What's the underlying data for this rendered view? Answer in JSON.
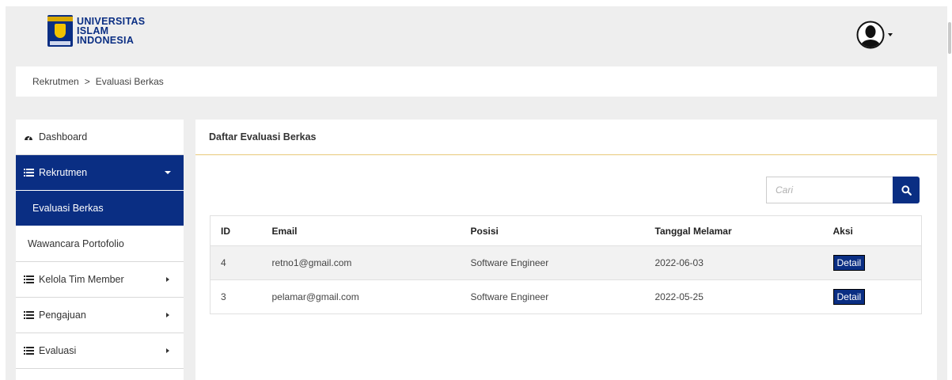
{
  "header": {
    "logo_lines": [
      "UNIVERSITAS",
      "ISLAM",
      "INDONESIA"
    ]
  },
  "breadcrumb": {
    "items": [
      "Rekrutmen",
      "Evaluasi Berkas"
    ],
    "separator": ">"
  },
  "sidebar": {
    "items": [
      {
        "label": "Dashboard",
        "icon": "dashboard-icon"
      },
      {
        "label": "Rekrutmen",
        "icon": "list-icon"
      },
      {
        "label": "Evaluasi Berkas"
      },
      {
        "label": "Wawancara Portofolio"
      },
      {
        "label": "Kelola Tim Member",
        "icon": "list-icon"
      },
      {
        "label": "Pengajuan",
        "icon": "list-icon"
      },
      {
        "label": "Evaluasi",
        "icon": "list-icon"
      }
    ]
  },
  "main": {
    "title": "Daftar Evaluasi Berkas",
    "search": {
      "placeholder": "Cari",
      "value": ""
    },
    "table": {
      "headers": [
        "ID",
        "Email",
        "Posisi",
        "Tanggal Melamar",
        "Aksi"
      ],
      "rows": [
        {
          "id": "4",
          "email": "retno1@gmail.com",
          "posisi": "Software Engineer",
          "tanggal": "2022-06-03",
          "aksi": "Detail"
        },
        {
          "id": "3",
          "email": "pelamar@gmail.com",
          "posisi": "Software Engineer",
          "tanggal": "2022-05-25",
          "aksi": "Detail"
        }
      ]
    }
  },
  "colors": {
    "primary": "#0a2e83",
    "background": "#eeeeee",
    "divider_accent": "#e8c97a"
  }
}
